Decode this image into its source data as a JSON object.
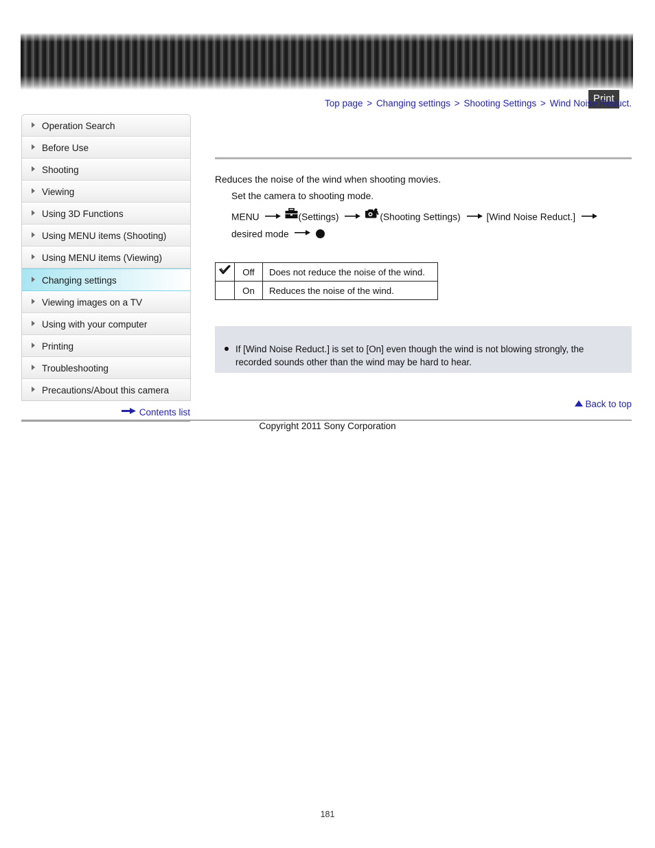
{
  "header": {
    "print_label": "Print"
  },
  "breadcrumb": {
    "separator": ">",
    "items": [
      {
        "label": "Top page"
      },
      {
        "label": "Changing settings"
      },
      {
        "label": "Shooting Settings"
      },
      {
        "label": "Wind Noise Reduct."
      }
    ]
  },
  "sidebar": {
    "items": [
      {
        "label": "Operation Search",
        "active": false
      },
      {
        "label": "Before Use",
        "active": false
      },
      {
        "label": "Shooting",
        "active": false
      },
      {
        "label": "Viewing",
        "active": false
      },
      {
        "label": "Using 3D Functions",
        "active": false
      },
      {
        "label": "Using MENU items (Shooting)",
        "active": false
      },
      {
        "label": "Using MENU items (Viewing)",
        "active": false
      },
      {
        "label": "Changing settings",
        "active": true
      },
      {
        "label": "Viewing images on a TV",
        "active": false
      },
      {
        "label": "Using with your computer",
        "active": false
      },
      {
        "label": "Printing",
        "active": false
      },
      {
        "label": "Troubleshooting",
        "active": false
      },
      {
        "label": "Precautions/About this camera",
        "active": false
      }
    ],
    "contents_list_label": "Contents list",
    "contents_list_icon": "right-arrow-icon"
  },
  "main": {
    "intro": "Reduces the noise of the wind when shooting movies.",
    "step": "Set the camera to shooting mode.",
    "menu_path": {
      "start": "MENU",
      "settings_icon": "toolbox-icon",
      "settings_label": "(Settings)",
      "shooting_icon": "camera-wrench-icon",
      "shooting_label": "(Shooting Settings)",
      "item_label": "[Wind Noise Reduct.]",
      "desired_label": "desired",
      "mode_label": "mode",
      "confirm_icon": "center-button-icon",
      "arrow_icon": "right-arrow-icon"
    },
    "table": {
      "check_icon": "checkmark-icon",
      "rows": [
        {
          "checked": true,
          "name": "Off",
          "desc": "Does not reduce the noise of the wind."
        },
        {
          "checked": false,
          "name": "On",
          "desc": "Reduces the noise of the wind."
        }
      ]
    },
    "note": {
      "bullet_icon": "bullet-dot-icon",
      "text": "If [Wind Noise Reduct.] is set to [On] even though the wind is not blowing strongly, the recorded sounds other than the wind may be hard to hear."
    }
  },
  "footer": {
    "back_to_top_label": "Back to top",
    "back_to_top_icon": "up-triangle-icon",
    "copyright": "Copyright 2011 Sony Corporation",
    "page_number": "181"
  },
  "colors": {
    "link": "#2222aa",
    "highlight": "#a9e6f2",
    "note_bg": "#dfe2e8",
    "rule": "#b3b3b3"
  }
}
